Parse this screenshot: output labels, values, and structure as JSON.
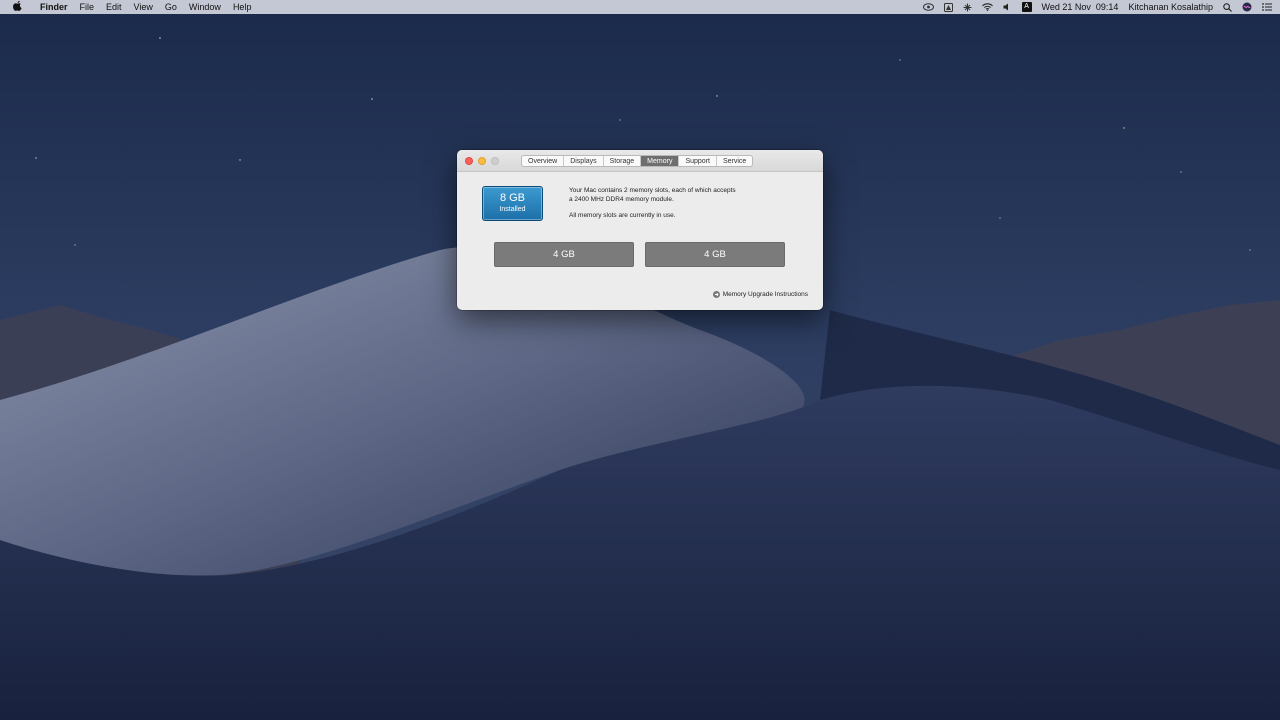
{
  "menubar": {
    "app_name": "Finder",
    "menus": [
      "File",
      "Edit",
      "View",
      "Go",
      "Window",
      "Help"
    ],
    "status": {
      "input_source": "A",
      "datetime": "Wed 21 Nov  09:14",
      "user": "Kitchanan Kosalathip"
    }
  },
  "window": {
    "tabs": [
      "Overview",
      "Displays",
      "Storage",
      "Memory",
      "Support",
      "Service"
    ],
    "active_tab": "Memory",
    "installed": {
      "size": "8 GB",
      "label": "Installed"
    },
    "info_line1": "Your Mac contains 2 memory slots, each of which accepts",
    "info_line2": "a 2400 MHz DDR4 memory module.",
    "info_line3": "All memory slots are currently in use.",
    "slots": [
      "4 GB",
      "4 GB"
    ],
    "upgrade_link": "Memory Upgrade Instructions"
  },
  "colors": {
    "accent_blue": "#1d6fa8",
    "slot_gray": "#7b7b7b",
    "close": "#fc605b",
    "minimize": "#fdbc40"
  }
}
